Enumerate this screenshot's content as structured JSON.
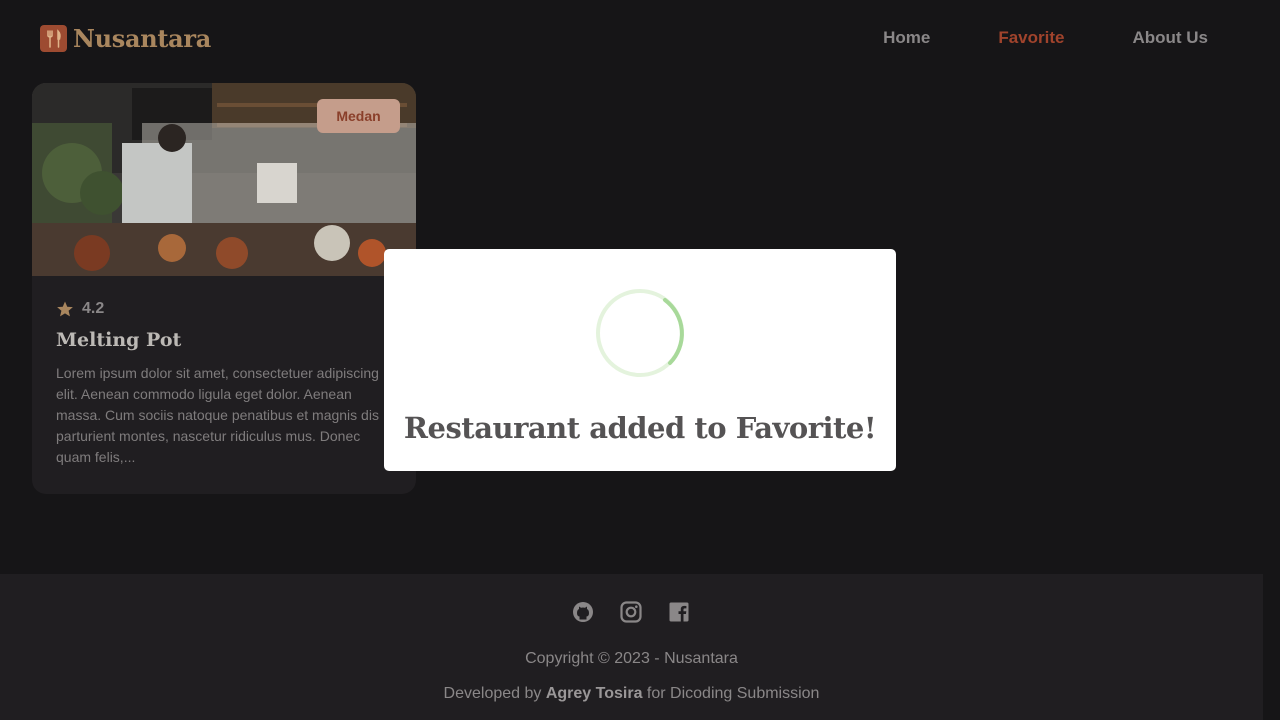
{
  "header": {
    "brand_name": "Nusantara",
    "nav": {
      "home": "Home",
      "favorite": "Favorite",
      "about": "About Us"
    }
  },
  "card": {
    "city_badge": "Medan",
    "rating": "4.2",
    "name": "Melting Pot",
    "description": "Lorem ipsum dolor sit amet, consectetuer adipiscing elit. Aenean commodo ligula eget dolor. Aenean massa. Cum sociis natoque penatibus et magnis dis parturient montes, nascetur ridiculus mus. Donec quam felis,..."
  },
  "modal": {
    "title": "Restaurant added to Favorite!",
    "icon": "loading-spinner"
  },
  "footer": {
    "social_icons": [
      "github-icon",
      "instagram-icon",
      "facebook-icon"
    ],
    "copyright": "Copyright © 2023 - Nusantara",
    "developed_prefix": "Developed by",
    "developer": "Agrey Tosira",
    "developed_suffix": "for Dicoding Submission"
  },
  "colors": {
    "background": "#161517",
    "surface": "#201e21",
    "accent": "#a0432c",
    "brand_gold": "#a9865e",
    "spinner": "#a8d99a"
  }
}
